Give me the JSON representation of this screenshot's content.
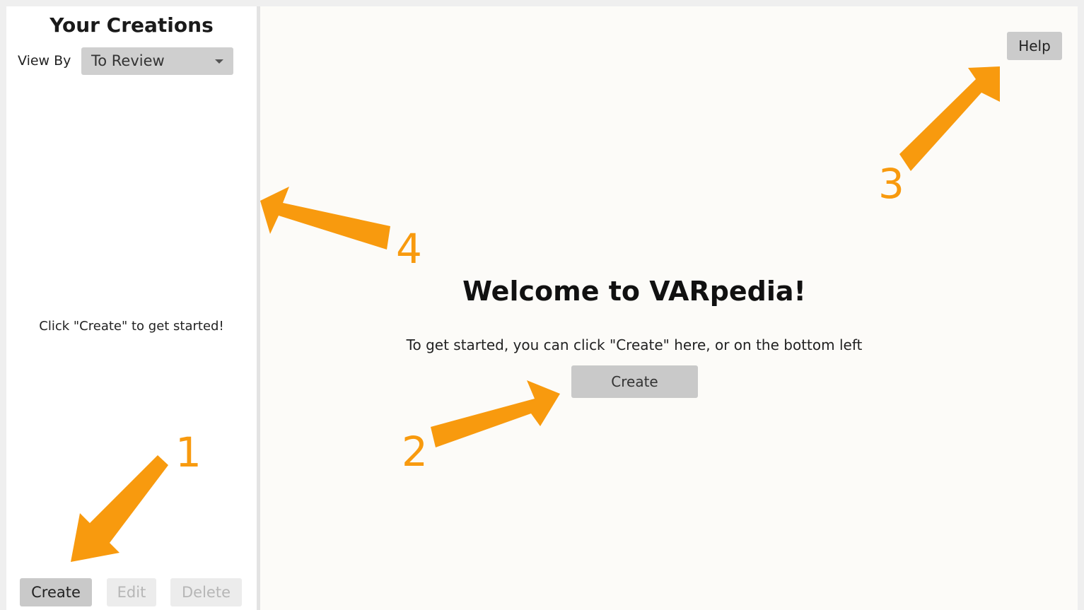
{
  "sidebar": {
    "title": "Your Creations",
    "view_by_label": "View By",
    "view_by_selected": "To Review",
    "empty_message": "Click \"Create\" to get started!",
    "buttons": {
      "create": "Create",
      "edit": "Edit",
      "delete": "Delete"
    }
  },
  "main": {
    "help_label": "Help",
    "welcome_title": "Welcome to VARpedia!",
    "welcome_subtitle": "To get started, you can click \"Create\" here, or on the bottom left",
    "create_label": "Create"
  },
  "annotations": {
    "color": "#f89a0e",
    "labels": [
      "1",
      "2",
      "3",
      "4"
    ]
  }
}
